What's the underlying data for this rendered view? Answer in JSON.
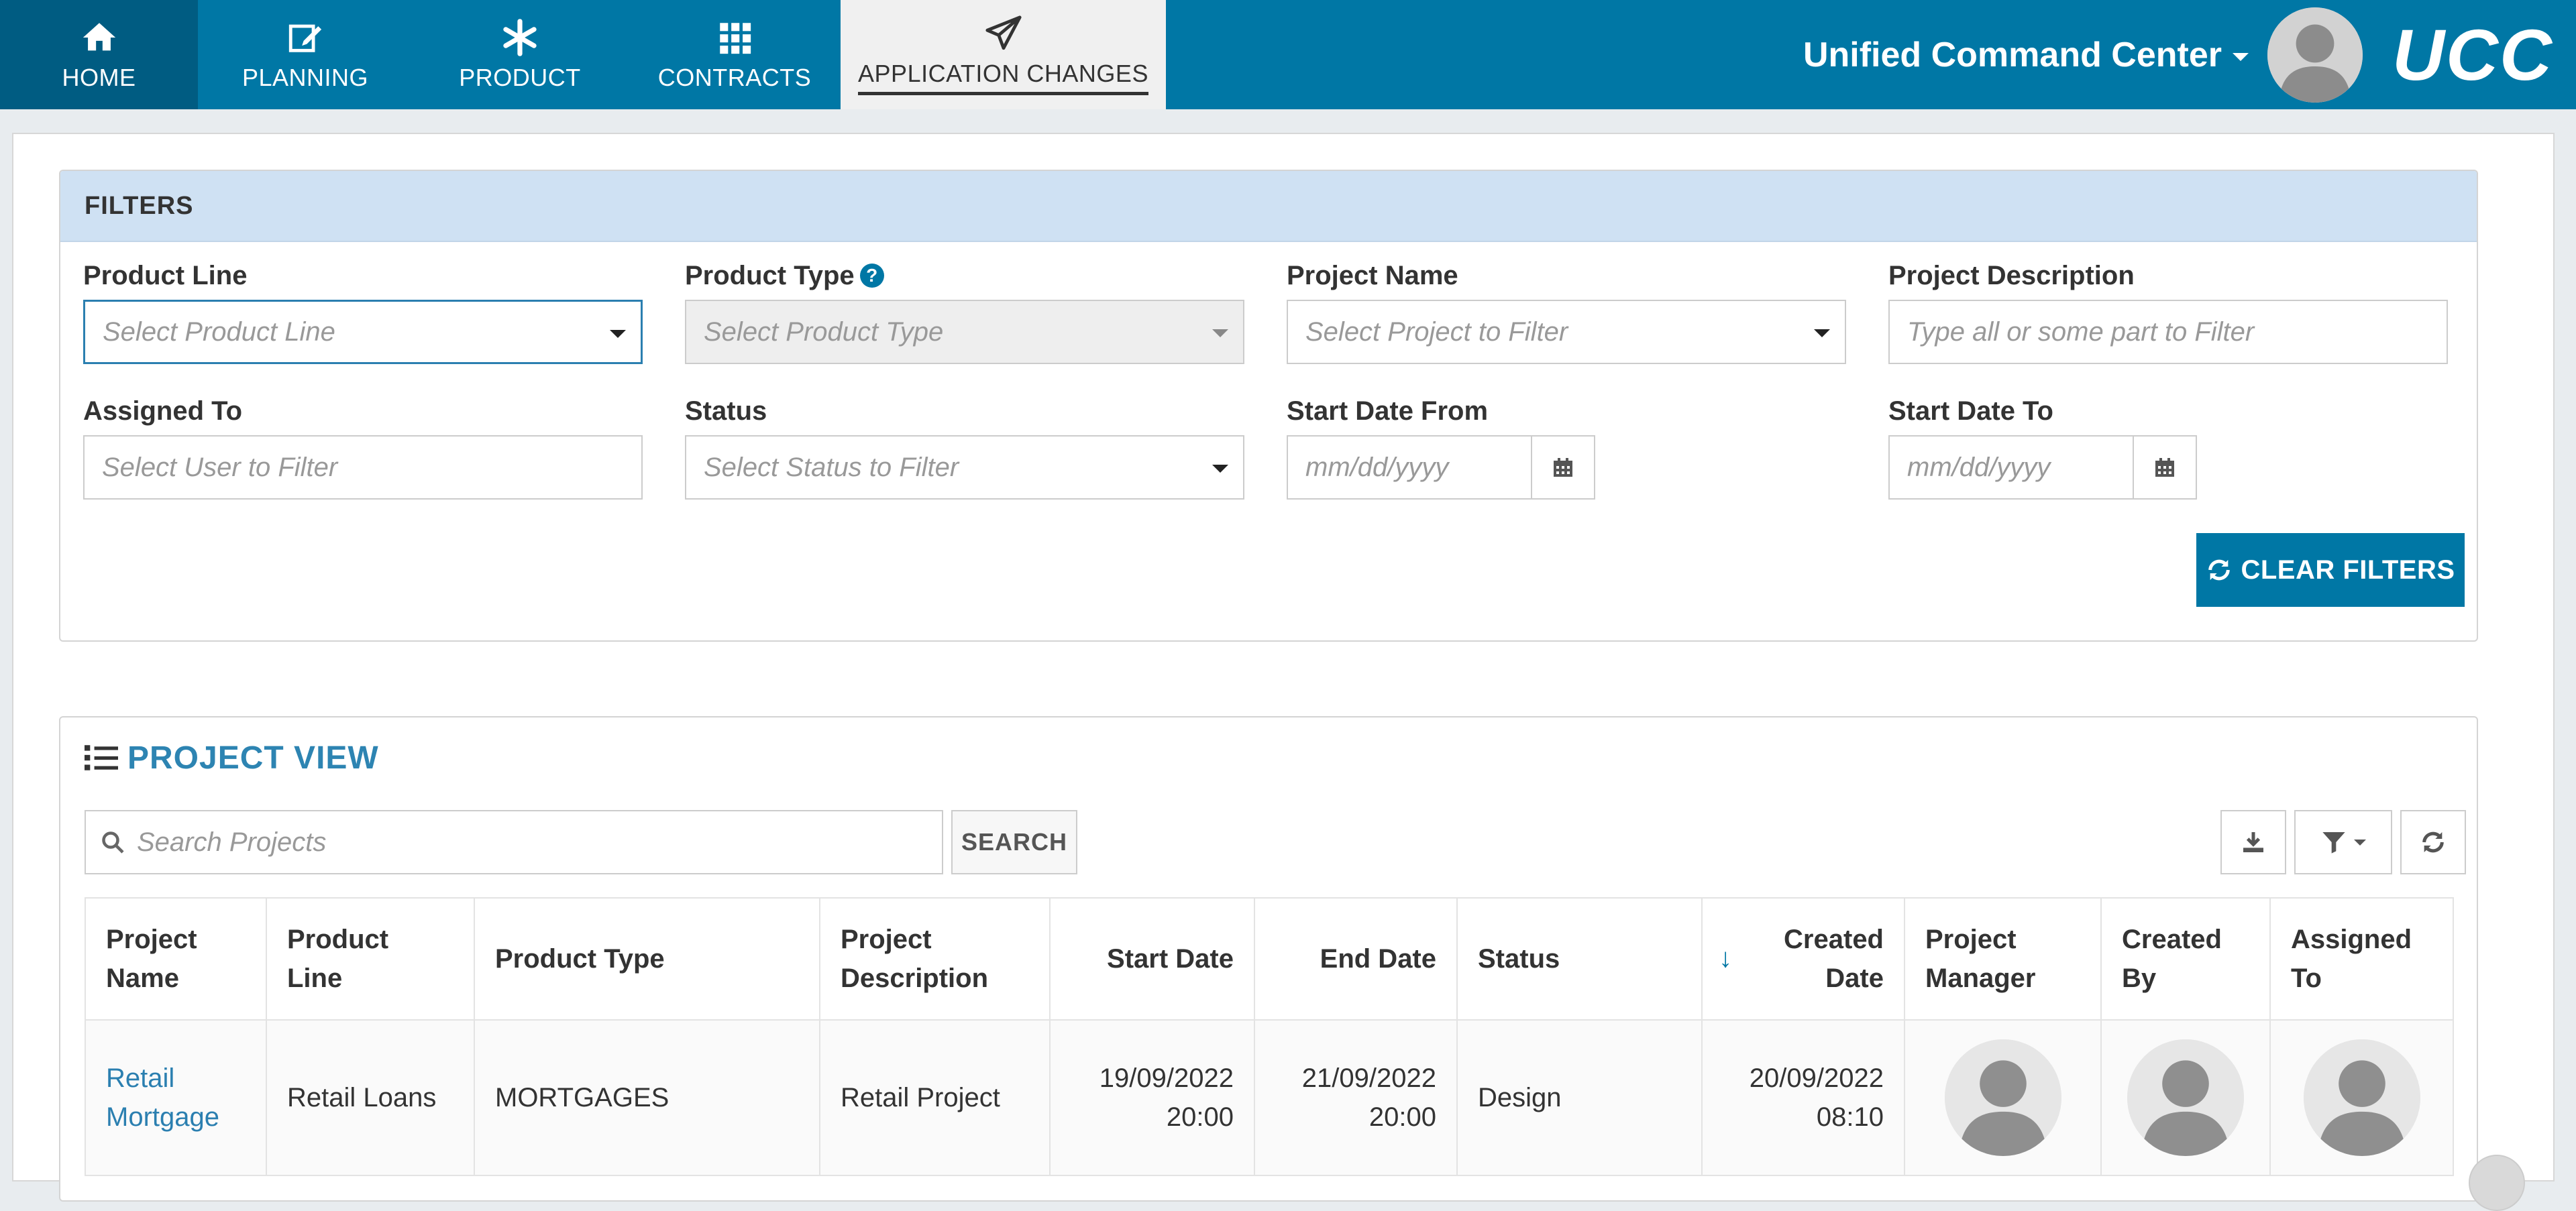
{
  "nav": {
    "tabs": [
      {
        "label": "HOME",
        "icon": "home-icon"
      },
      {
        "label": "PLANNING",
        "icon": "edit-icon"
      },
      {
        "label": "PRODUCT",
        "icon": "asterisk-icon"
      },
      {
        "label": "CONTRACTS",
        "icon": "grid-icon"
      },
      {
        "label": "APPLICATION CHANGES",
        "icon": "paper-plane-icon"
      }
    ],
    "active_tab": "APPLICATION CHANGES",
    "app_menu_label": "Unified Command Center",
    "logo_text": "UCC"
  },
  "filters": {
    "heading": "FILTERS",
    "product_line": {
      "label": "Product Line",
      "placeholder": "Select Product Line"
    },
    "product_type": {
      "label": "Product Type",
      "placeholder": "Select Product Type",
      "help": "?"
    },
    "project_name": {
      "label": "Project Name",
      "placeholder": "Select Project to Filter"
    },
    "project_description": {
      "label": "Project Description",
      "placeholder": "Type all or some part to Filter"
    },
    "assigned_to": {
      "label": "Assigned To",
      "placeholder": "Select User to Filter"
    },
    "status": {
      "label": "Status",
      "placeholder": "Select Status to Filter"
    },
    "start_date_from": {
      "label": "Start Date From",
      "placeholder": "mm/dd/yyyy"
    },
    "start_date_to": {
      "label": "Start Date To",
      "placeholder": "mm/dd/yyyy"
    },
    "clear_label": "CLEAR FILTERS"
  },
  "project_view": {
    "title": "PROJECT VIEW",
    "search_placeholder": "Search Projects",
    "search_label": "SEARCH",
    "columns": {
      "project_name": [
        "Project",
        "Name"
      ],
      "product_line": [
        "Product",
        "Line"
      ],
      "product_type": "Product Type",
      "project_description": [
        "Project",
        "Description"
      ],
      "start_date": "Start Date",
      "end_date": "End Date",
      "status": "Status",
      "created_date": [
        "Created",
        "Date"
      ],
      "project_manager": [
        "Project",
        "Manager"
      ],
      "created_by": [
        "Created",
        "By"
      ],
      "assigned_to": [
        "Assigned",
        "To"
      ]
    },
    "sort_indicator": "↓",
    "rows": [
      {
        "project_name": [
          "Retail",
          "Mortgage"
        ],
        "product_line": "Retail Loans",
        "product_type": "MORTGAGES",
        "project_description": "Retail Project",
        "start_date": [
          "19/09/2022",
          "20:00"
        ],
        "end_date": [
          "21/09/2022",
          "20:00"
        ],
        "status": "Design",
        "created_date": [
          "20/09/2022",
          "08:10"
        ]
      }
    ]
  },
  "colors": {
    "nav_bg": "#0077a5",
    "nav_home_bg": "#005c82",
    "accent": "#0077a5",
    "filters_header_bg": "#cfe1f3",
    "link": "#2b7fb0"
  }
}
